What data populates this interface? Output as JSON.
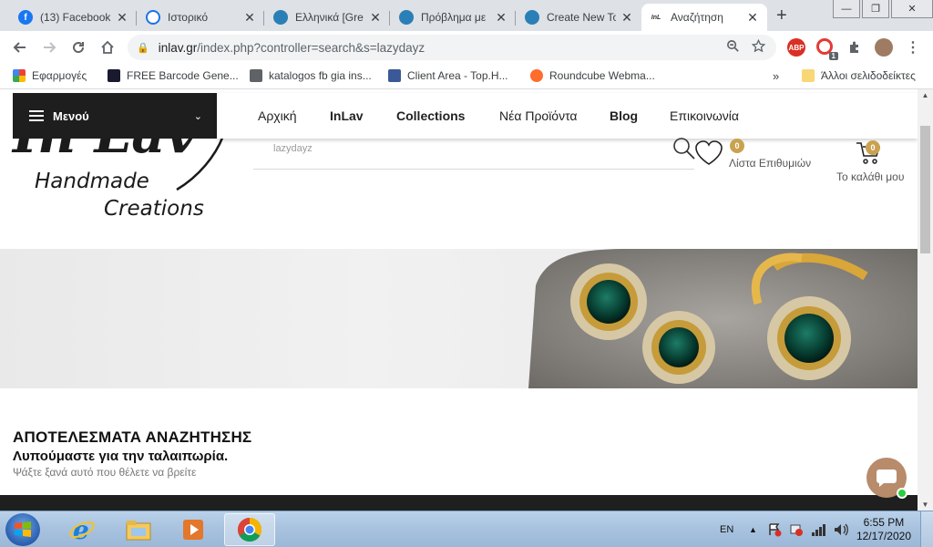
{
  "browser": {
    "tabs": [
      {
        "title": "(13) Facebook",
        "icon": "facebook-icon",
        "color": "#1877f2"
      },
      {
        "title": "Ιστορικό",
        "icon": "history-icon",
        "color": "#1a73e8"
      },
      {
        "title": "Ελληνικά [Gre",
        "icon": "forum-icon",
        "color": "#2a7fb6"
      },
      {
        "title": "Πρόβλημα με",
        "icon": "forum-icon",
        "color": "#2a7fb6"
      },
      {
        "title": "Create New To",
        "icon": "forum-icon",
        "color": "#2a7fb6"
      },
      {
        "title": "Αναζήτηση",
        "icon": "inlav-icon",
        "color": "#333333"
      }
    ],
    "url_host": "inlav.gr",
    "url_rest": "/index.php?controller=search&s=lazydayz",
    "extension_badge": "1",
    "bookmarks": [
      {
        "label": "Εφαρμογές",
        "icon": "apps-icon"
      },
      {
        "label": "FREE Barcode Gene...",
        "icon": "barcode-icon"
      },
      {
        "label": "katalogos fb gia ins...",
        "icon": "page-icon"
      },
      {
        "label": "Client Area - Top.H...",
        "icon": "host-icon"
      },
      {
        "label": "Roundcube Webma...",
        "icon": "cpanel-icon"
      }
    ],
    "other_bookmarks": "Άλλοι σελιδοδείκτες"
  },
  "site": {
    "menu_label": "Μενού",
    "nav": [
      {
        "label": "Αρχική",
        "bold": false
      },
      {
        "label": "InLav",
        "bold": true
      },
      {
        "label": "Collections",
        "bold": true
      },
      {
        "label": "Νέα Προϊόντα",
        "bold": false
      },
      {
        "label": "Blog",
        "bold": true
      },
      {
        "label": "Επικοινωνία",
        "bold": false
      }
    ],
    "logo": {
      "main": "In Lav",
      "line1": "Handmade",
      "line2": "Creations"
    },
    "search_value": "lazydayz",
    "wishlist_label": "Λίστα Επιθυμιών",
    "wishlist_count": "0",
    "cart_label": "Το καλάθι μου",
    "cart_count": "0",
    "results_title": "ΑΠΟΤΕΛΕΣΜΑΤΑ ΑΝΑΖΗΤΗΣΗΣ",
    "results_sorry": "Λυπούμαστε για την ταλαιπωρία.",
    "results_hint": "Ψάξτε ξανά αυτό που θέλετε να βρείτε"
  },
  "taskbar": {
    "lang": "EN",
    "time": "6:55 PM",
    "date": "12/17/2020"
  },
  "colors": {
    "accent_badge": "#caa24f",
    "menu_bg": "#1e1e1e",
    "chat_bubble": "#b88b6b"
  }
}
